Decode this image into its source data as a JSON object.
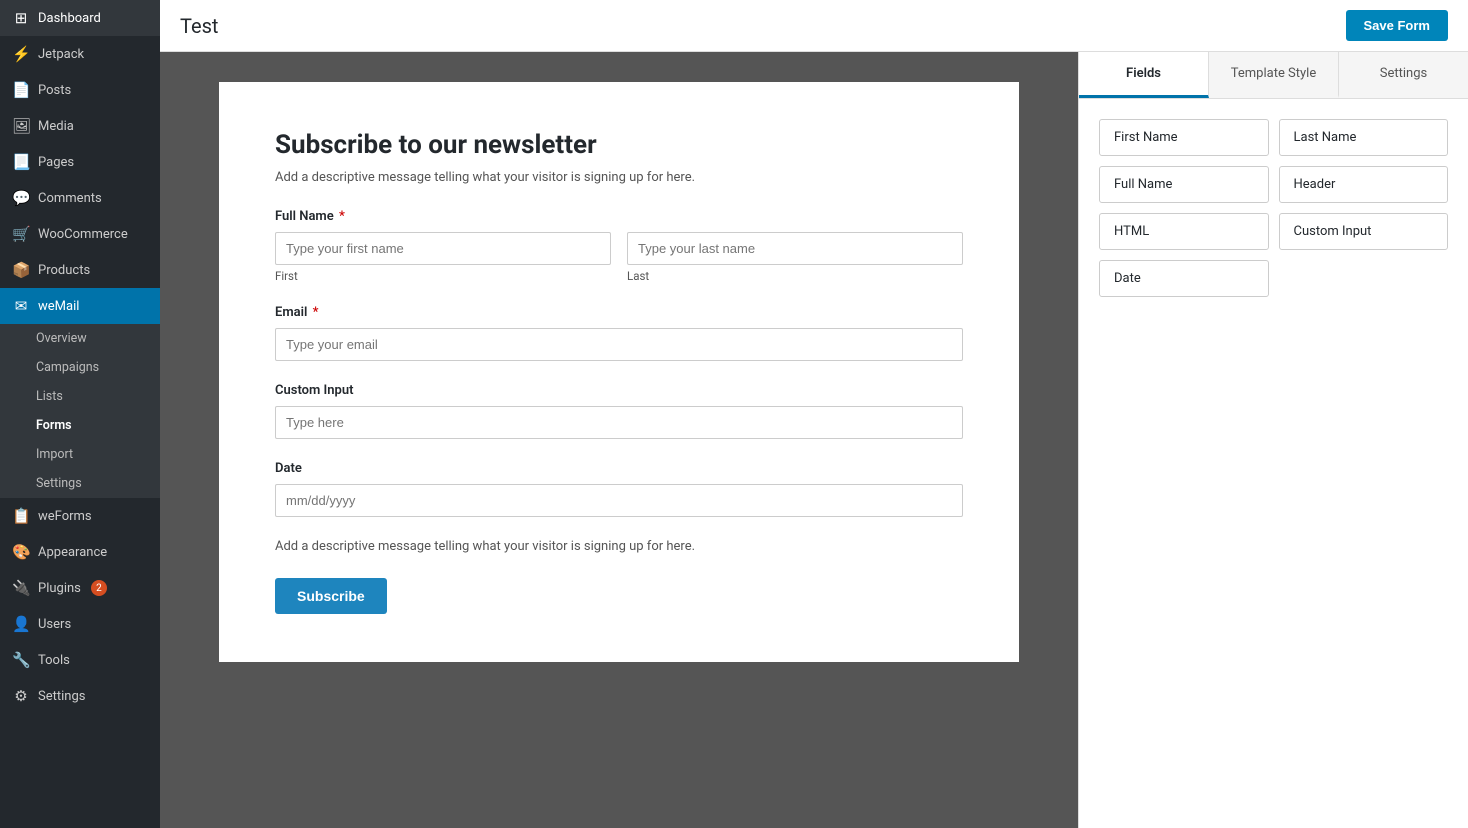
{
  "page": {
    "title": "Test",
    "save_button": "Save Form"
  },
  "sidebar": {
    "items": [
      {
        "id": "dashboard",
        "label": "Dashboard",
        "icon": "⊞",
        "active": false
      },
      {
        "id": "jetpack",
        "label": "Jetpack",
        "icon": "⚡",
        "active": false
      },
      {
        "id": "posts",
        "label": "Posts",
        "icon": "📄",
        "active": false
      },
      {
        "id": "media",
        "label": "Media",
        "icon": "🖼",
        "active": false
      },
      {
        "id": "pages",
        "label": "Pages",
        "icon": "📃",
        "active": false
      },
      {
        "id": "comments",
        "label": "Comments",
        "icon": "💬",
        "active": false
      },
      {
        "id": "woocommerce",
        "label": "WooCommerce",
        "icon": "🛒",
        "active": false
      },
      {
        "id": "products",
        "label": "Products",
        "icon": "📦",
        "active": false
      },
      {
        "id": "wemail",
        "label": "weMail",
        "icon": "✉",
        "active": true
      },
      {
        "id": "weforms",
        "label": "weForms",
        "icon": "📋",
        "active": false
      },
      {
        "id": "appearance",
        "label": "Appearance",
        "icon": "🎨",
        "active": false
      },
      {
        "id": "plugins",
        "label": "Plugins",
        "icon": "🔌",
        "active": false,
        "badge": "2"
      },
      {
        "id": "users",
        "label": "Users",
        "icon": "👤",
        "active": false
      },
      {
        "id": "tools",
        "label": "Tools",
        "icon": "🔧",
        "active": false
      },
      {
        "id": "settings",
        "label": "Settings",
        "icon": "⚙",
        "active": false
      }
    ],
    "wemail_submenu": [
      {
        "id": "overview",
        "label": "Overview",
        "active": false
      },
      {
        "id": "campaigns",
        "label": "Campaigns",
        "active": false
      },
      {
        "id": "lists",
        "label": "Lists",
        "active": false
      },
      {
        "id": "forms",
        "label": "Forms",
        "active": true
      },
      {
        "id": "import",
        "label": "Import",
        "active": false
      },
      {
        "id": "settings",
        "label": "Settings",
        "active": false
      }
    ]
  },
  "form": {
    "title": "Subscribe to our newsletter",
    "description": "Add a descriptive message telling what your visitor is signing up for here.",
    "fields": [
      {
        "id": "fullname",
        "label": "Full Name",
        "required": true,
        "type": "split",
        "first_placeholder": "Type your first name",
        "last_placeholder": "Type your last name",
        "first_sublabel": "First",
        "last_sublabel": "Last"
      },
      {
        "id": "email",
        "label": "Email",
        "required": true,
        "type": "text",
        "placeholder": "Type your email"
      },
      {
        "id": "custom_input",
        "label": "Custom Input",
        "required": false,
        "type": "text",
        "placeholder": "Type here"
      },
      {
        "id": "date",
        "label": "Date",
        "required": false,
        "type": "date",
        "placeholder": "mm/dd/yyyy"
      }
    ],
    "footer_description": "Add a descriptive message telling what your visitor is signing up for here.",
    "submit_button": "Subscribe"
  },
  "right_panel": {
    "tabs": [
      {
        "id": "fields",
        "label": "Fields",
        "active": true
      },
      {
        "id": "template_style",
        "label": "Template Style",
        "active": false
      },
      {
        "id": "settings",
        "label": "Settings",
        "active": false
      }
    ],
    "field_chips": [
      {
        "id": "first_name",
        "label": "First Name"
      },
      {
        "id": "last_name",
        "label": "Last Name"
      },
      {
        "id": "full_name",
        "label": "Full Name"
      },
      {
        "id": "header",
        "label": "Header"
      },
      {
        "id": "html",
        "label": "HTML"
      },
      {
        "id": "custom_input",
        "label": "Custom Input"
      },
      {
        "id": "date",
        "label": "Date"
      }
    ]
  }
}
